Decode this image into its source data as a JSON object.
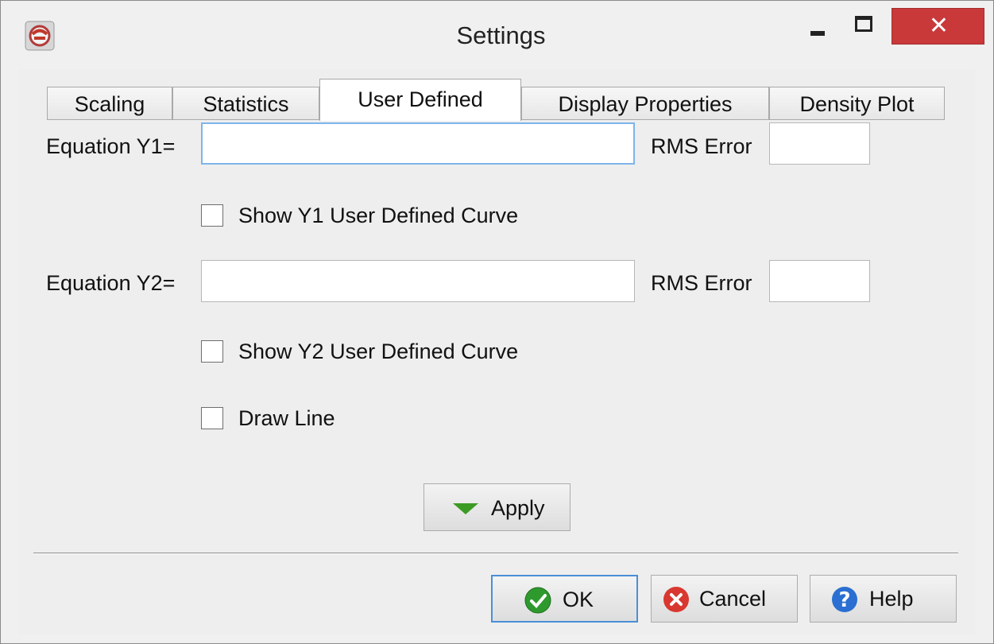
{
  "window": {
    "title": "Settings",
    "close_glyph": "✕"
  },
  "tabs": [
    {
      "label": "Scaling",
      "active": false
    },
    {
      "label": "Statistics",
      "active": false
    },
    {
      "label": "User Defined",
      "active": true
    },
    {
      "label": "Display Properties",
      "active": false
    },
    {
      "label": "Density Plot",
      "active": false
    }
  ],
  "form": {
    "equation_y1_label": "Equation Y1=",
    "equation_y1_value": "",
    "rms_error_1_label": "RMS Error",
    "rms_error_1_value": "",
    "show_y1_label": "Show Y1 User Defined Curve",
    "show_y1_checked": false,
    "equation_y2_label": "Equation Y2=",
    "equation_y2_value": "",
    "rms_error_2_label": "RMS Error",
    "rms_error_2_value": "",
    "show_y2_label": "Show Y2 User Defined Curve",
    "show_y2_checked": false,
    "draw_line_label": "Draw Line",
    "draw_line_checked": false,
    "apply_label": "Apply"
  },
  "buttons": {
    "ok": "OK",
    "cancel": "Cancel",
    "help": "Help"
  },
  "colors": {
    "close_button": "#c9393a",
    "focus_border": "#7eb4ea",
    "apply_arrow": "#3c9b23",
    "ok_icon": "#2e9a2e",
    "cancel_icon": "#d8382f",
    "help_icon": "#2a6fd1"
  }
}
